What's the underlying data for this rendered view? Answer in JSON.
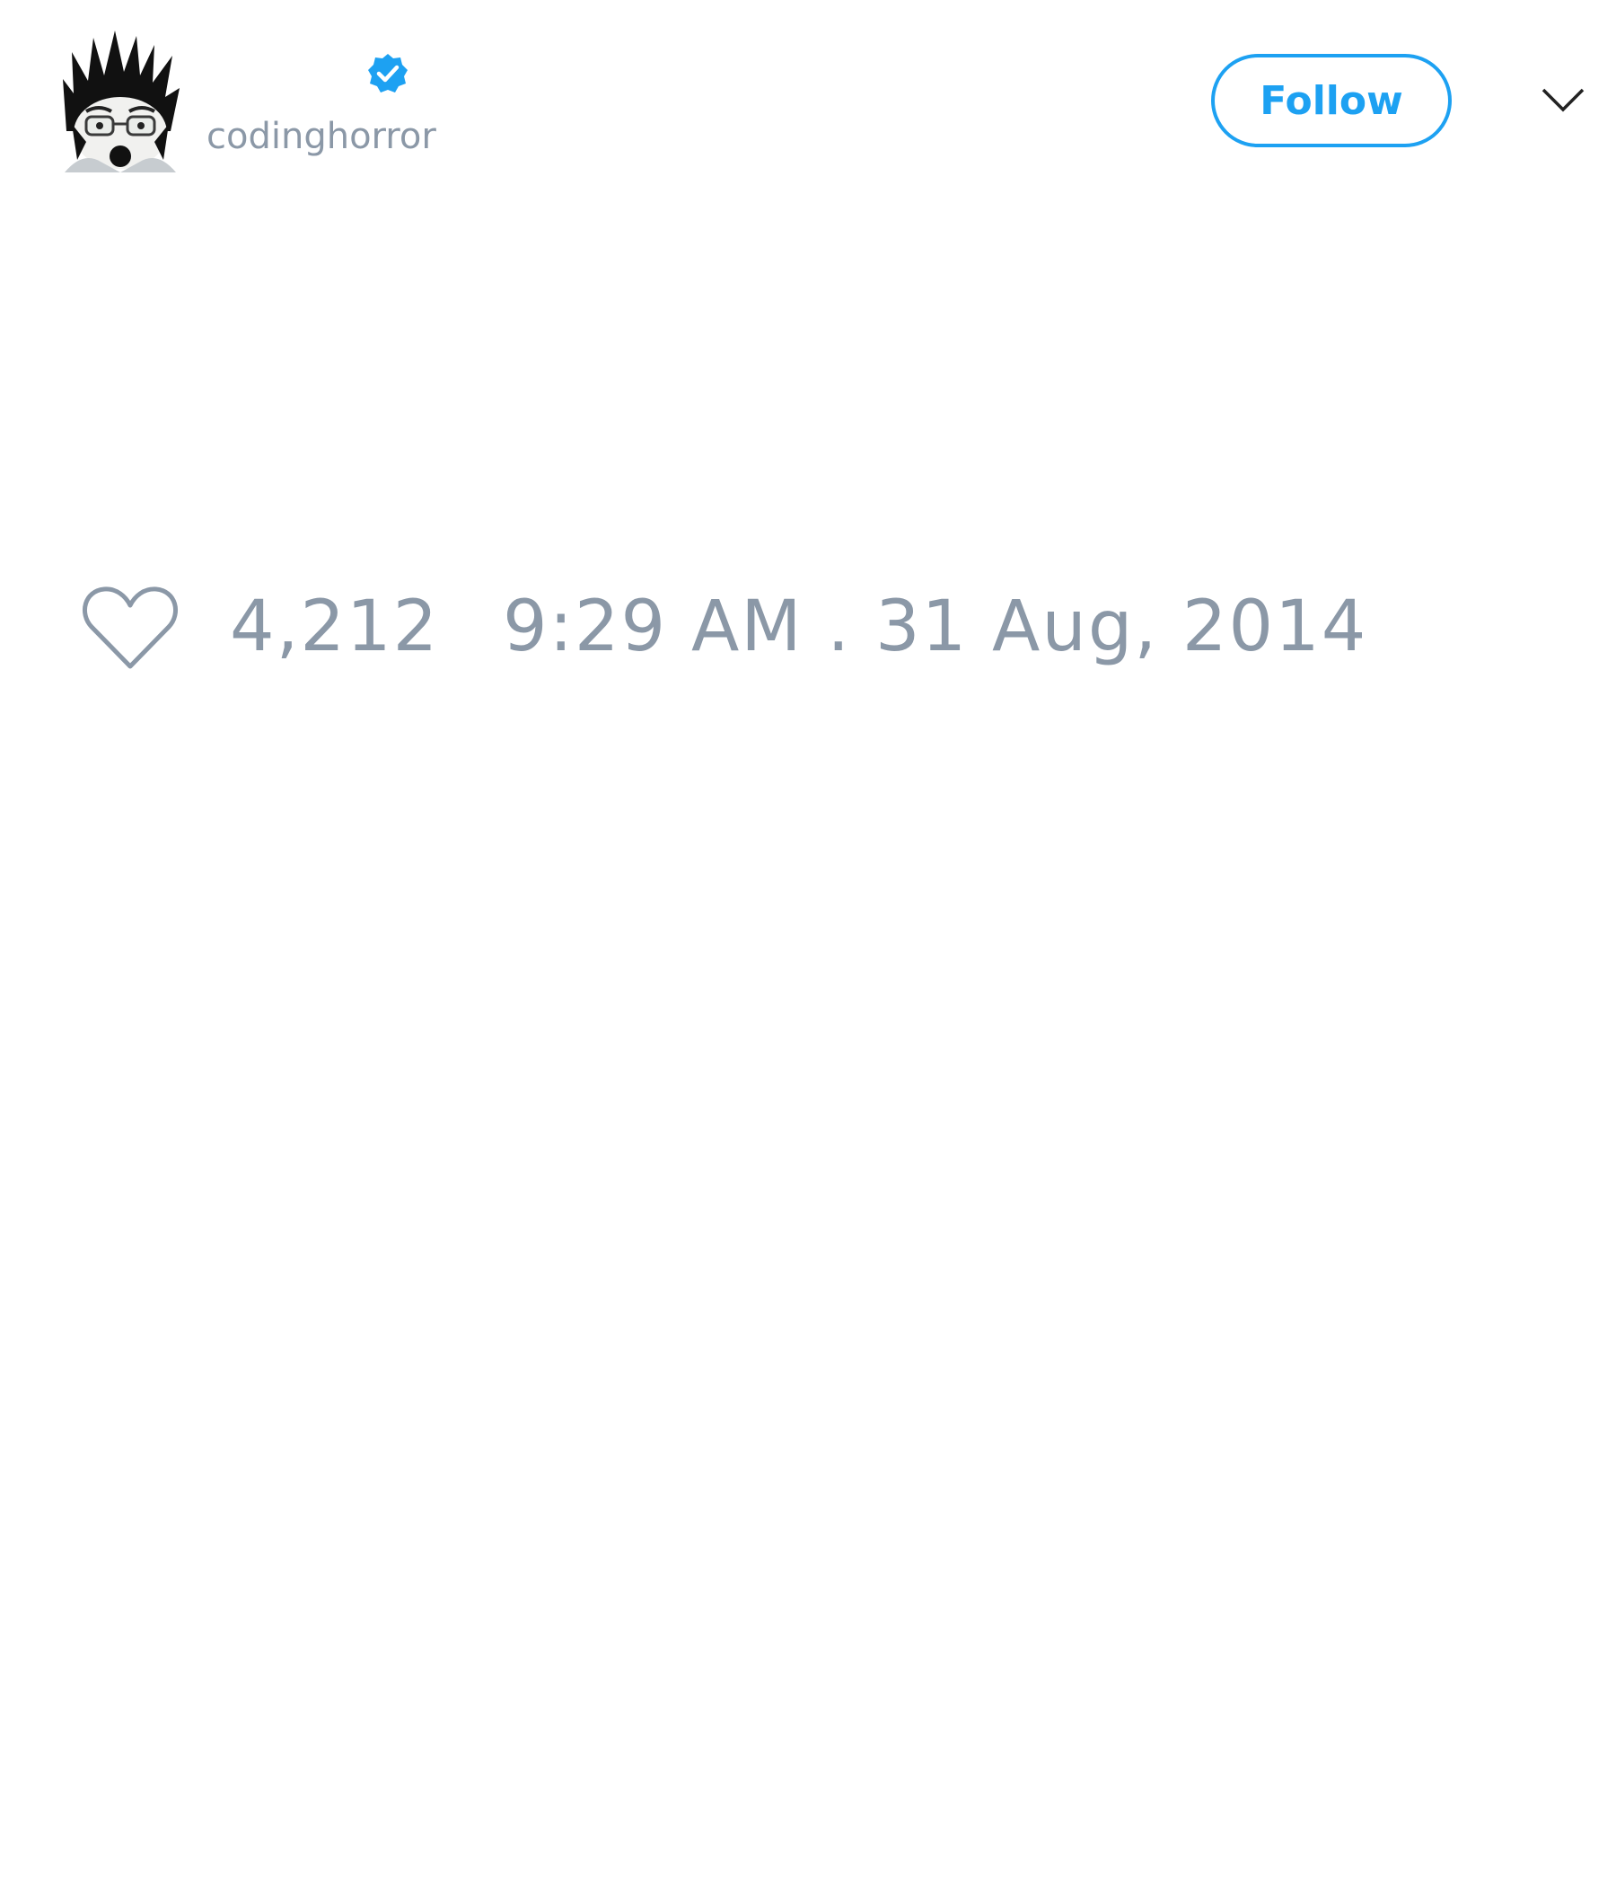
{
  "author": {
    "handle": "codinghorror",
    "avatar_icon": "avatar-image",
    "verified_icon": "verified-badge-icon"
  },
  "actions": {
    "follow_label": "Follow",
    "menu_icon": "chevron-down-icon"
  },
  "tweet": {
    "like_icon": "heart-icon",
    "like_count": "4,212",
    "timestamp": "9:29 AM . 31 Aug, 2014"
  },
  "colors": {
    "accent": "#1da1f2",
    "muted_text": "#8b98a7",
    "background": "#ffffff"
  }
}
